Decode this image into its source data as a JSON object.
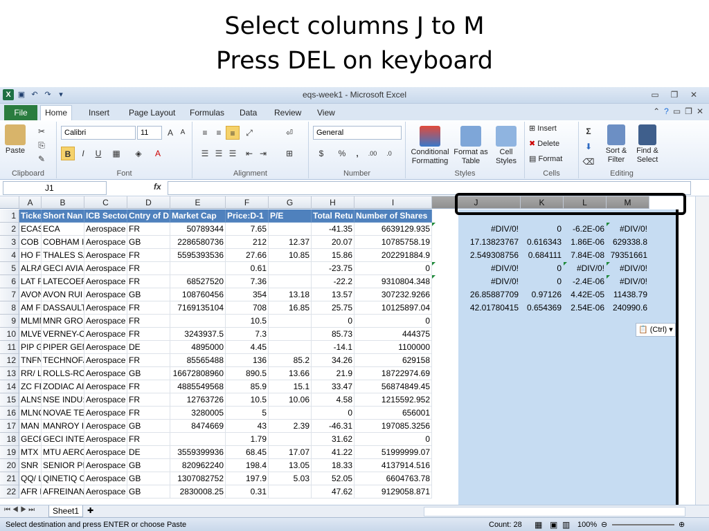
{
  "slide": {
    "line1": "Select columns J to M",
    "line2": "Press DEL on keyboard"
  },
  "window": {
    "title": "eqs-week1 - Microsoft Excel"
  },
  "tabs": [
    "File",
    "Home",
    "Insert",
    "Page Layout",
    "Formulas",
    "Data",
    "Review",
    "View"
  ],
  "ribbon": {
    "clipboard": {
      "paste": "Paste",
      "label": "Clipboard"
    },
    "font": {
      "name": "Calibri",
      "size": "11",
      "label": "Font",
      "bold": "B",
      "italic": "I",
      "underline": "U"
    },
    "alignment": {
      "label": "Alignment"
    },
    "number": {
      "format": "General",
      "percent": "%",
      "comma": ",",
      "inc_dec": ".00",
      "dec_dec": ".0",
      "label": "Number"
    },
    "styles": {
      "cond": "Conditional Formatting",
      "table": "Format as Table",
      "cell": "Cell Styles",
      "label": "Styles"
    },
    "cells": {
      "insert": "Insert",
      "delete": "Delete",
      "format": "Format",
      "label": "Cells"
    },
    "editing": {
      "sum": "Σ",
      "sort": "Sort & Filter",
      "find": "Find & Select",
      "label": "Editing"
    }
  },
  "formula": {
    "name_box": "J1",
    "fx": "fx",
    "value": ""
  },
  "columns": [
    "A",
    "B",
    "C",
    "D",
    "E",
    "F",
    "G",
    "H",
    "I",
    "J",
    "K",
    "L",
    "M"
  ],
  "rows": [
    [
      "Ticker",
      "Short Nan",
      "ICB Sector",
      "Cntry of D",
      "Market Cap",
      "Price:D-1",
      "P/E",
      "Total Retu",
      "Number of Shares",
      "",
      "",
      "",
      ""
    ],
    [
      "ECASA  FF",
      "ECA",
      "Aerospace",
      "FR",
      "50789344",
      "7.65",
      "",
      "-41.35",
      "6639129.935",
      "#DIV/0!",
      "0",
      "-6.2E-06",
      "#DIV/0!"
    ],
    [
      "COB     LN",
      "COBHAM I",
      "Aerospace",
      "GB",
      "2286580736",
      "212",
      "12.37",
      "20.07",
      "10785758.19",
      "17.13823767",
      "0.616343",
      "1.86E-06",
      "629338.8"
    ],
    [
      "HO     FP E",
      "THALES SA",
      "Aerospace",
      "FR",
      "5595393536",
      "27.66",
      "10.85",
      "15.86",
      "202291884.9",
      "2.549308756",
      "0.684111",
      "7.84E-08",
      "79351661"
    ],
    [
      "ALRAI  FP",
      "GECI AVIA",
      "Aerospace",
      "FR",
      "",
      "0.61",
      "",
      "-23.75",
      "0",
      "#DIV/0!",
      "0",
      "#DIV/0!",
      "#DIV/0!"
    ],
    [
      "LAT    FP E",
      "LATECOER",
      "Aerospace",
      "FR",
      "68527520",
      "7.36",
      "",
      "-22.2",
      "9310804.348",
      "#DIV/0!",
      "0",
      "-2.4E-06",
      "#DIV/0!"
    ],
    [
      "AVON   LN",
      "AVON RUI",
      "Aerospace",
      "GB",
      "108760456",
      "354",
      "13.18",
      "13.57",
      "307232.9266",
      "26.85887709",
      "0.97126",
      "4.42E-05",
      "11438.79"
    ],
    [
      "AM     FP E",
      "DASSAULT",
      "Aerospace",
      "FR",
      "7169135104",
      "708",
      "16.85",
      "25.75",
      "10125897.04",
      "42.01780415",
      "0.654369",
      "2.54E-06",
      "240990.6"
    ],
    [
      "MLMNR  F",
      "MNR GRO",
      "Aerospace",
      "FR",
      "",
      "10.5",
      "",
      "0",
      "0",
      "",
      "",
      "",
      ""
    ],
    [
      "MLVER  FI",
      "VERNEY-C",
      "Aerospace",
      "FR",
      "3243937.5",
      "7.3",
      "",
      "85.73",
      "444375",
      "",
      "",
      "",
      ""
    ],
    [
      "PIP    GR E",
      "PIPER GEN",
      "Aerospace",
      "DE",
      "4895000",
      "4.45",
      "",
      "-14.1",
      "1100000",
      "",
      "",
      "",
      ""
    ],
    [
      "TNFN   FP",
      "TECHNOF/",
      "Aerospace",
      "FR",
      "85565488",
      "136",
      "85.2",
      "34.26",
      "629158",
      "",
      "",
      "",
      ""
    ],
    [
      "RR/    LN E",
      "ROLLS-RO",
      "Aerospace",
      "GB",
      "16672808960",
      "890.5",
      "13.66",
      "21.9",
      "18722974.69",
      "",
      "",
      "",
      ""
    ],
    [
      "ZC     FP E",
      "ZODIAC AI",
      "Aerospace",
      "FR",
      "4885549568",
      "85.9",
      "15.1",
      "33.47",
      "56874849.45",
      "",
      "",
      "",
      ""
    ],
    [
      "ALNSE  FP",
      "NSE INDU:",
      "Aerospace",
      "FR",
      "12763726",
      "10.5",
      "10.06",
      "4.58",
      "1215592.952",
      "",
      "",
      "",
      ""
    ],
    [
      "MLNOT  F",
      "NOVAE TE",
      "Aerospace",
      "FR",
      "3280005",
      "5",
      "",
      "0",
      "656001",
      "",
      "",
      "",
      ""
    ],
    [
      "MAN    LN",
      "MANROY I",
      "Aerospace",
      "GB",
      "8474669",
      "43",
      "2.39",
      "-46.31",
      "197085.3256",
      "",
      "",
      "",
      ""
    ],
    [
      "GECP   FP",
      "GECI INTE",
      "Aerospace",
      "FR",
      "",
      "1.79",
      "",
      "31.62",
      "0",
      "",
      "",
      "",
      ""
    ],
    [
      "MTX    GR",
      "MTU AERC",
      "Aerospace",
      "DE",
      "3559399936",
      "68.45",
      "17.07",
      "41.22",
      "51999999.07",
      "",
      "",
      "",
      ""
    ],
    [
      "SNR    LN",
      "SENIOR PI",
      "Aerospace",
      "GB",
      "820962240",
      "198.4",
      "13.05",
      "18.33",
      "4137914.516",
      "",
      "",
      "",
      ""
    ],
    [
      "QQ/    LN",
      "QINETIQ C",
      "Aerospace",
      "GB",
      "1307082752",
      "197.9",
      "5.03",
      "52.05",
      "6604763.78",
      "",
      "",
      "",
      ""
    ],
    [
      "AFR    PW",
      "AFREINAN",
      "Aerospace",
      "GB",
      "2830008.25",
      "0.31",
      "",
      "47.62",
      "9129058.871",
      "",
      "",
      "",
      ""
    ]
  ],
  "paste_options": "(Ctrl)",
  "sheet": {
    "name": "Sheet1"
  },
  "status": {
    "message": "Select destination and press ENTER or choose Paste",
    "count": "Count: 28",
    "zoom": "100%"
  }
}
